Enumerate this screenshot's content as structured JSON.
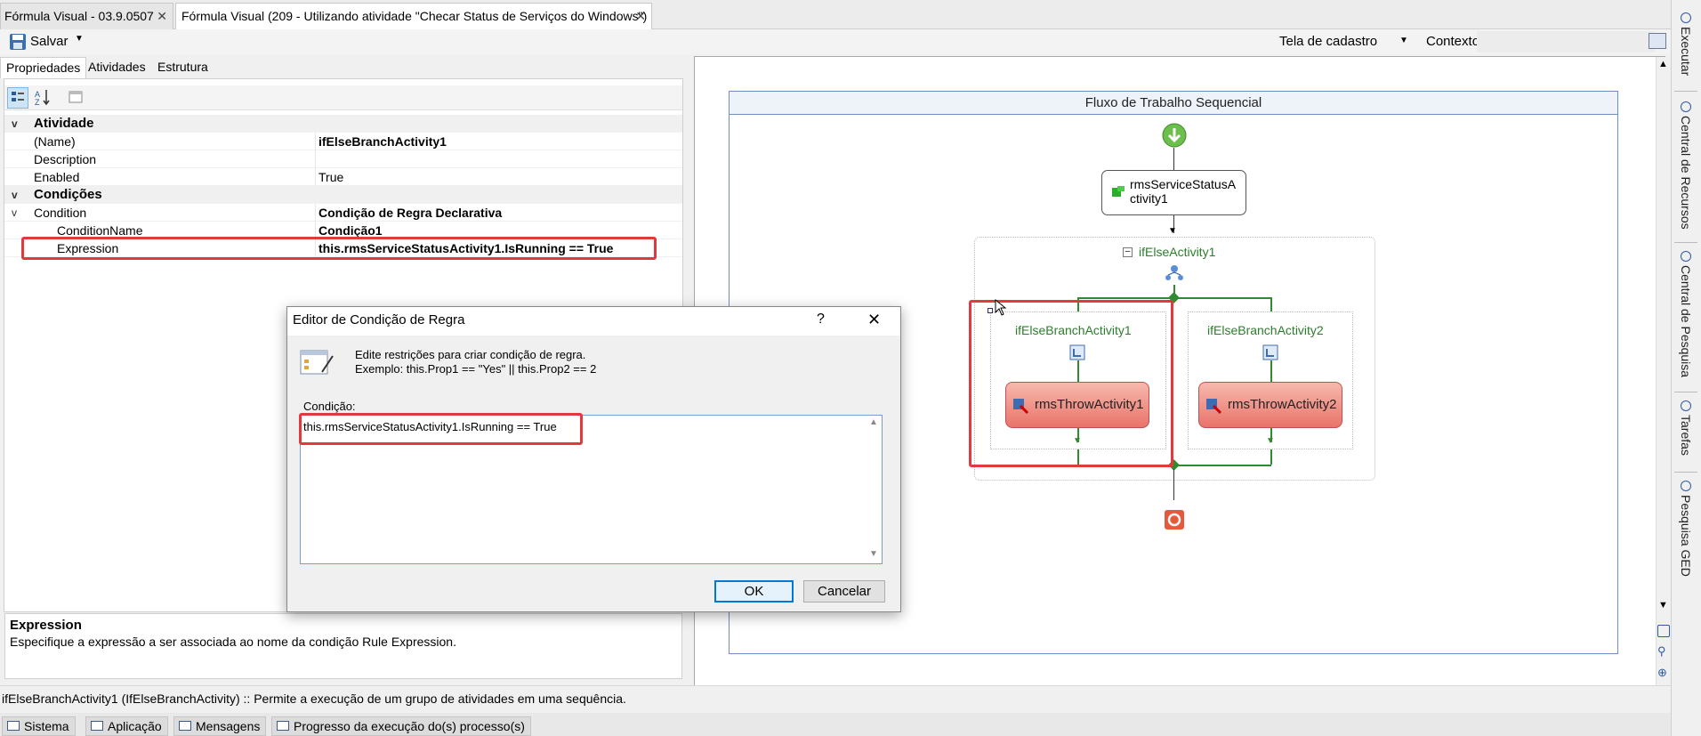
{
  "tabs": [
    {
      "label": "Fórmula Visual - 03.9.0507"
    },
    {
      "label": "Fórmula Visual (209 - Utilizando atividade \"Checar Status de Serviços do Windows\")"
    }
  ],
  "toolbar": {
    "save_label": "Salvar",
    "screen_label": "Tela de cadastro",
    "context_label": "Contexto:"
  },
  "panel_tabs": [
    "Propriedades",
    "Atividades",
    "Estrutura"
  ],
  "properties": {
    "cat_activity": "Atividade",
    "name_label": "(Name)",
    "name_value": "ifElseBranchActivity1",
    "description_label": "Description",
    "enabled_label": "Enabled",
    "enabled_value": "True",
    "cat_conditions": "Condições",
    "condition_label": "Condition",
    "condition_value": "Condição de Regra Declarativa",
    "condition_name_label": "ConditionName",
    "condition_name_value": "Condição1",
    "expression_label": "Expression",
    "expression_value": "this.rmsServiceStatusActivity1.IsRunning == True"
  },
  "description": {
    "title": "Expression",
    "text": "Especifique a expressão a ser associada ao nome da condição Rule Expression."
  },
  "status_text": "ifElseBranchActivity1  (IfElseBranchActivity)  :: Permite a execução de um grupo de atividades em uma sequência.",
  "bottom_tabs": [
    "Sistema",
    "Aplicação",
    "Mensagens",
    "Progresso da execução do(s) processo(s)"
  ],
  "designer": {
    "header": "Fluxo de Trabalho Sequencial",
    "service_activity_line1": "rmsServiceStatusA",
    "service_activity_line2": "ctivity1",
    "ifelse": "ifElseActivity1",
    "branch1": "ifElseBranchActivity1",
    "branch2": "ifElseBranchActivity2",
    "throw1": "rmsThrowActivity1",
    "throw2": "rmsThrowActivity2"
  },
  "dialog": {
    "title": "Editor de Condição de Regra",
    "help": "?",
    "info_line1": "Edite restrições para criar condição de regra.",
    "info_line2": "Exemplo: this.Prop1 == \"Yes\" || this.Prop2 == 2",
    "condition_label": "Condição:",
    "condition_value": "this.rmsServiceStatusActivity1.IsRunning == True",
    "ok": "OK",
    "cancel": "Cancelar"
  },
  "right_tabs": [
    "Executar",
    "Central de Recursos",
    "Central de Pesquisa",
    "Tarefas",
    "Pesquisa GED"
  ],
  "colors": {
    "highlight": "#e0393e",
    "selection": "#0078d7",
    "branch_green": "#2b7d2b",
    "throw_red": "#e9736a"
  }
}
